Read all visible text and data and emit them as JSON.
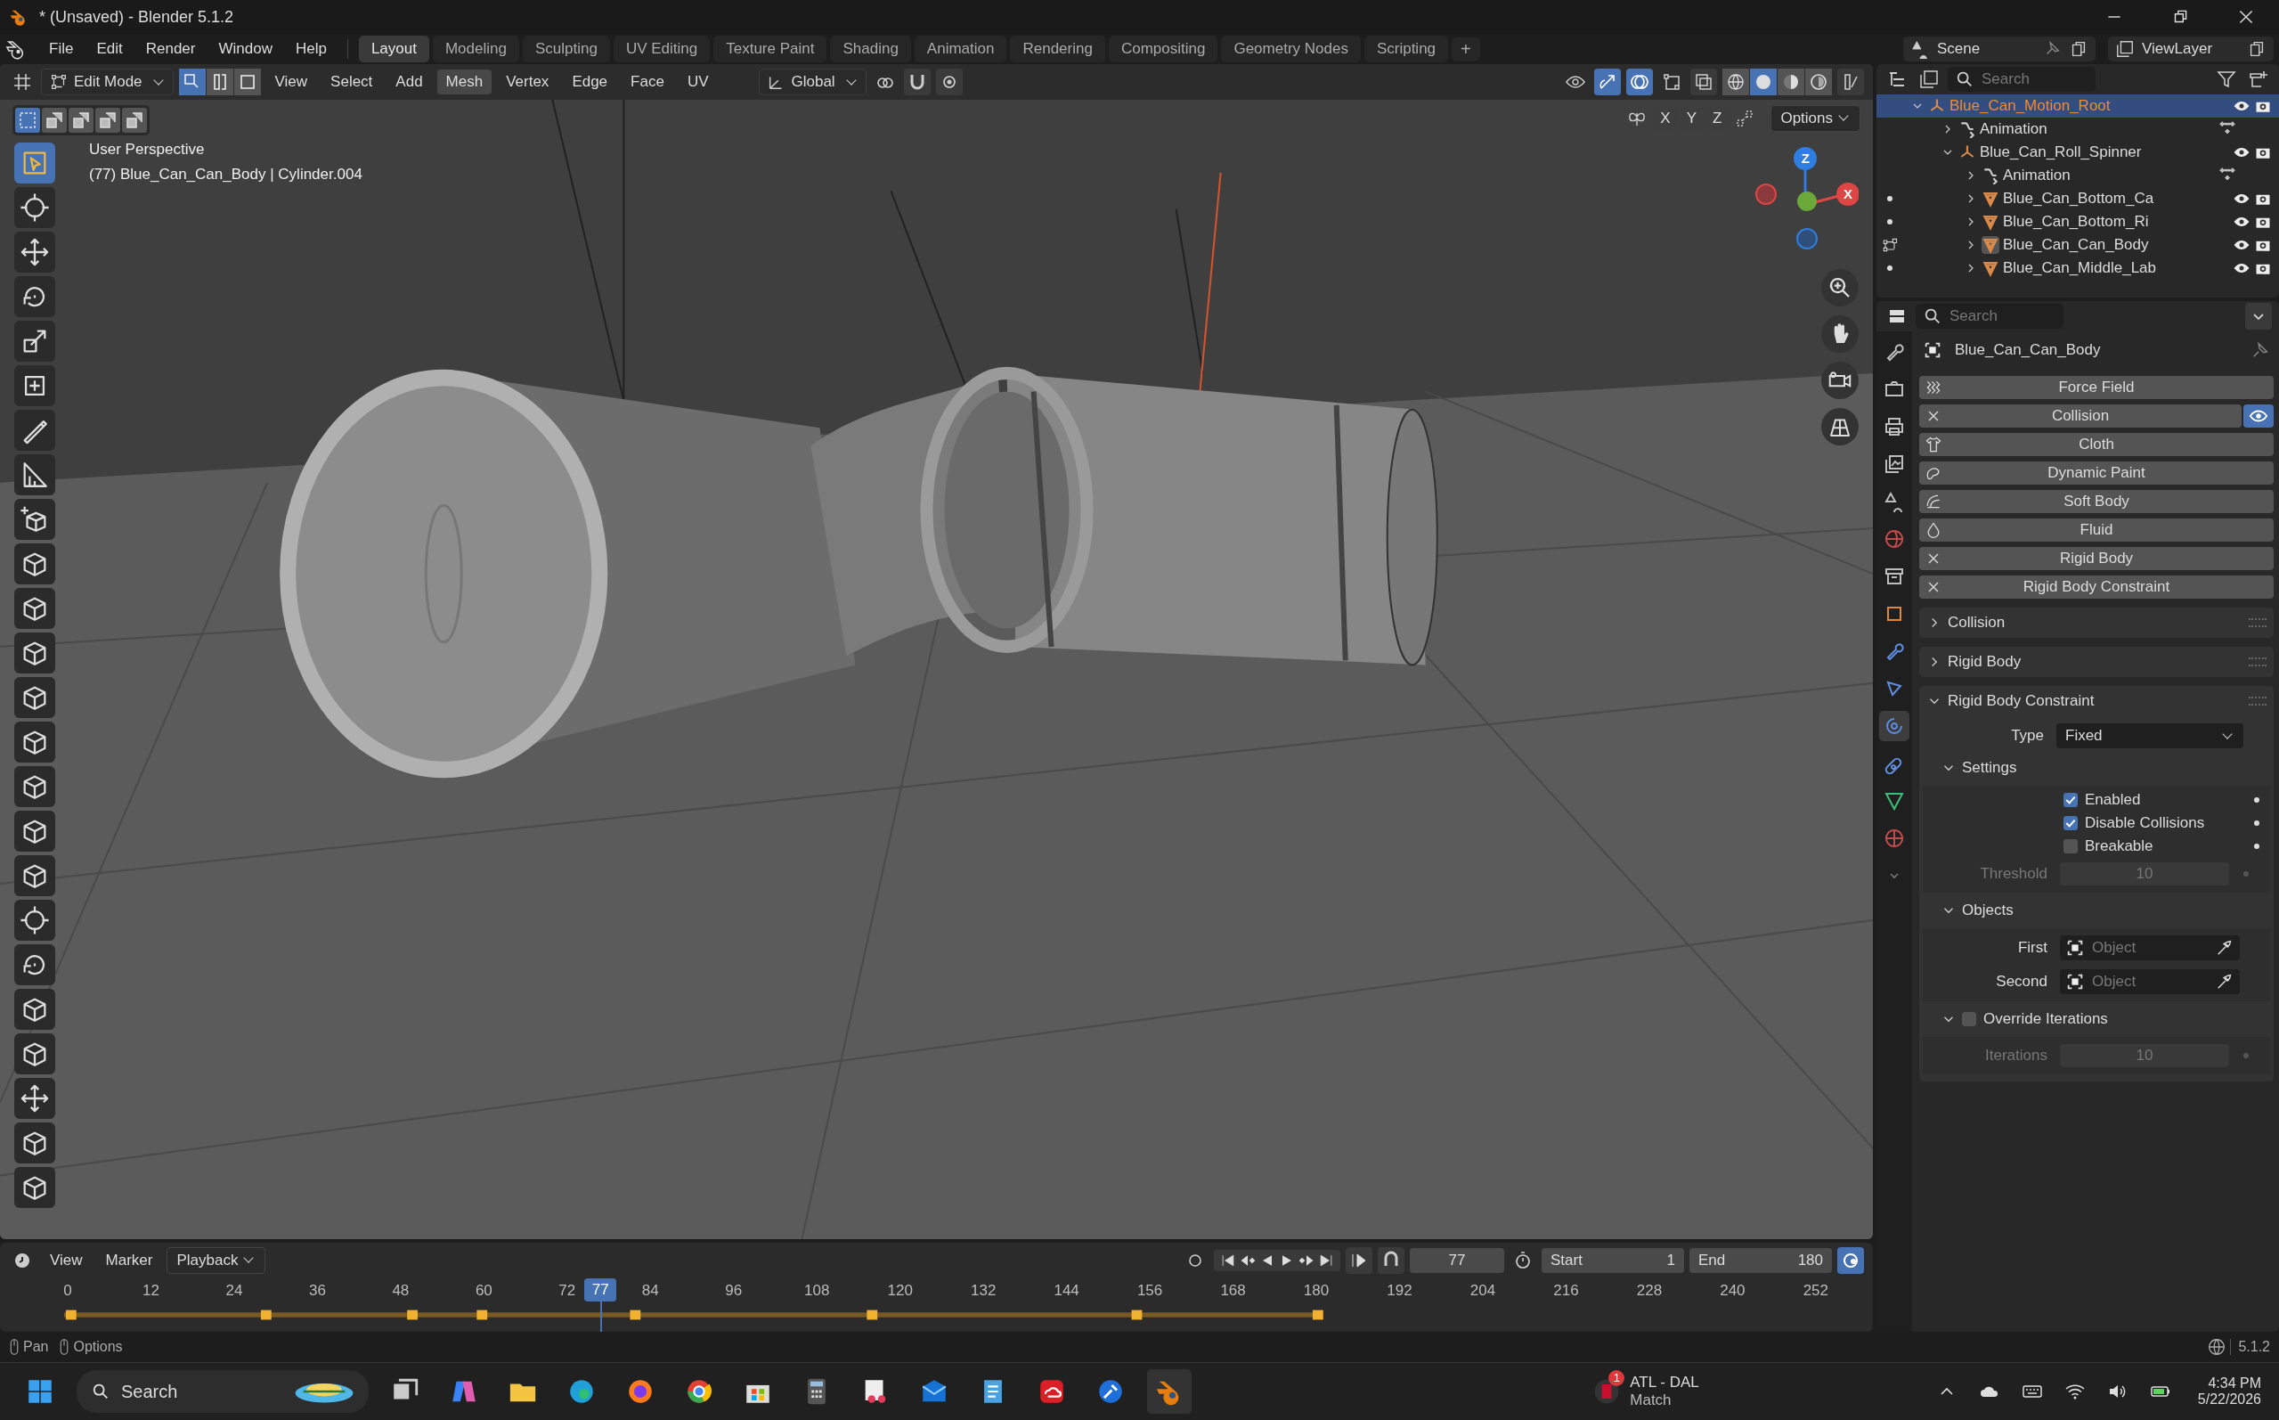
{
  "window": {
    "title": "* (Unsaved) - Blender 5.1.2"
  },
  "menu": [
    "File",
    "Edit",
    "Render",
    "Window",
    "Help"
  ],
  "workspaces": [
    {
      "label": "Layout",
      "selected": true
    },
    {
      "label": "Modeling",
      "selected": false
    },
    {
      "label": "Sculpting",
      "selected": false
    },
    {
      "label": "UV Editing",
      "selected": false
    },
    {
      "label": "Texture Paint",
      "selected": false
    },
    {
      "label": "Shading",
      "selected": false
    },
    {
      "label": "Animation",
      "selected": false
    },
    {
      "label": "Rendering",
      "selected": false
    },
    {
      "label": "Compositing",
      "selected": false
    },
    {
      "label": "Geometry Nodes",
      "selected": false
    },
    {
      "label": "Scripting",
      "selected": false
    }
  ],
  "add_workspace": "+",
  "scene": "Scene",
  "view_layer": "ViewLayer",
  "viewport": {
    "mode": "Edit Mode",
    "select_modes": [
      {
        "kind": "vertex",
        "selected": true
      },
      {
        "kind": "edge",
        "selected": false
      },
      {
        "kind": "face",
        "selected": false
      }
    ],
    "menus": [
      {
        "label": "View",
        "selected": false
      },
      {
        "label": "Select",
        "selected": false
      },
      {
        "label": "Add",
        "selected": false
      },
      {
        "label": "Mesh",
        "selected": true
      },
      {
        "label": "Vertex",
        "selected": false
      },
      {
        "label": "Edge",
        "selected": false
      },
      {
        "label": "Face",
        "selected": false
      },
      {
        "label": "UV",
        "selected": false
      }
    ],
    "orientation": "Global",
    "shading_modes": [
      {
        "kind": "wireframe",
        "selected": false
      },
      {
        "kind": "solid",
        "selected": true
      },
      {
        "kind": "material",
        "selected": false
      },
      {
        "kind": "rendered",
        "selected": false
      }
    ],
    "overlay_lines": [
      "User Perspective",
      "(77) Blue_Can_Can_Body | Cylinder.004"
    ],
    "mirror_axes": [
      "X",
      "Y",
      "Z"
    ],
    "options": "Options",
    "gizmo_labels": [
      {
        "kind": "z",
        "label": "Z"
      },
      {
        "kind": "x",
        "label": "X"
      }
    ],
    "tools": [
      {
        "kind": "select",
        "selected": true
      },
      {
        "kind": "cursor",
        "selected": false
      },
      {
        "kind": "move",
        "selected": false
      },
      {
        "kind": "rotate",
        "selected": false
      },
      {
        "kind": "scale",
        "selected": false
      },
      {
        "kind": "transform",
        "selected": false
      },
      {
        "kind": "annotate",
        "selected": false
      },
      {
        "kind": "measure",
        "selected": false
      },
      {
        "kind": "add-cube",
        "selected": false
      },
      {
        "kind": "cube",
        "selected": false
      },
      {
        "kind": "cube",
        "selected": false
      },
      {
        "kind": "cube",
        "selected": false
      },
      {
        "kind": "cube",
        "selected": false
      },
      {
        "kind": "cube",
        "selected": false
      },
      {
        "kind": "cube",
        "selected": false
      },
      {
        "kind": "cube",
        "selected": false
      },
      {
        "kind": "cube",
        "selected": false
      },
      {
        "kind": "cursor",
        "selected": false
      },
      {
        "kind": "rotate",
        "selected": false
      },
      {
        "kind": "cube",
        "selected": false
      },
      {
        "kind": "cube",
        "selected": false
      },
      {
        "kind": "move",
        "selected": false
      },
      {
        "kind": "cube",
        "selected": false
      },
      {
        "kind": "cube",
        "selected": false
      }
    ]
  },
  "outliner": {
    "search": "Search",
    "items": [
      {
        "label": "Blue_Can_Motion_Root",
        "kind": "empty",
        "selected": true,
        "expanded": true,
        "children": [
          {
            "label": "Animation",
            "kind": "animation",
            "selected": false,
            "expanded": false
          },
          {
            "label": "Blue_Can_Roll_Spinner",
            "kind": "empty",
            "selected": false,
            "expanded": true,
            "children": [
              {
                "label": "Animation",
                "kind": "animation",
                "selected": false,
                "expanded": false
              },
              {
                "label": "Blue_Can_Bottom_Ca",
                "kind": "mesh",
                "selected": false,
                "expanded": false,
                "editing": false
              },
              {
                "label": "Blue_Can_Bottom_Ri",
                "kind": "mesh",
                "selected": false,
                "expanded": false,
                "editing": false
              },
              {
                "label": "Blue_Can_Can_Body",
                "kind": "mesh",
                "selected": false,
                "expanded": false,
                "editing": true
              },
              {
                "label": "Blue_Can_Middle_Lab",
                "kind": "mesh",
                "selected": false,
                "expanded": false,
                "editing": false
              }
            ]
          }
        ]
      }
    ]
  },
  "properties": {
    "search": "Search",
    "object": "Blue_Can_Can_Body",
    "tabs": [
      {
        "kind": "tool",
        "selected": false
      },
      {
        "kind": "render",
        "selected": false
      },
      {
        "kind": "output",
        "selected": false
      },
      {
        "kind": "view-layer",
        "selected": false
      },
      {
        "kind": "scene",
        "selected": false
      },
      {
        "kind": "world",
        "selected": false
      },
      {
        "kind": "collection",
        "selected": false
      },
      {
        "kind": "object",
        "selected": false
      },
      {
        "kind": "modifiers",
        "selected": false
      },
      {
        "kind": "particles",
        "selected": false
      },
      {
        "kind": "physics",
        "selected": true
      },
      {
        "kind": "constraints",
        "selected": false
      },
      {
        "kind": "data",
        "selected": false
      },
      {
        "kind": "material",
        "selected": false
      }
    ],
    "physics": [
      {
        "label": "Force Field",
        "kind": "force-field",
        "enabled": false,
        "viewport_visible": false
      },
      {
        "label": "Collision",
        "kind": "collision",
        "enabled": true,
        "viewport_visible": true
      },
      {
        "label": "Cloth",
        "kind": "cloth",
        "enabled": false,
        "viewport_visible": false
      },
      {
        "label": "Dynamic Paint",
        "kind": "dynamic-paint",
        "enabled": false,
        "viewport_visible": false
      },
      {
        "label": "Soft Body",
        "kind": "soft-body",
        "enabled": false,
        "viewport_visible": false
      },
      {
        "label": "Fluid",
        "kind": "fluid",
        "enabled": false,
        "viewport_visible": false
      },
      {
        "label": "Rigid Body",
        "kind": "rigid-body",
        "enabled": true,
        "viewport_visible": false
      },
      {
        "label": "Rigid Body Constraint",
        "kind": "rigid-body-constraint",
        "enabled": true,
        "viewport_visible": false
      }
    ],
    "panels": [
      {
        "title": "Collision",
        "expanded": false
      },
      {
        "title": "Rigid Body",
        "expanded": false
      }
    ],
    "constraint": {
      "title": "Rigid Body Constraint",
      "expanded": true,
      "type_label": "Type",
      "type_value": "Fixed",
      "settings": {
        "title": "Settings",
        "expanded": true,
        "checks": [
          {
            "label": "Enabled",
            "checked": true
          },
          {
            "label": "Disable Collisions",
            "checked": true
          },
          {
            "label": "Breakable",
            "checked": false
          }
        ],
        "threshold": {
          "label": "Threshold",
          "value": "10",
          "disabled": true
        }
      },
      "objects": {
        "title": "Objects",
        "expanded": true,
        "fields": [
          {
            "label": "First",
            "placeholder": "Object"
          },
          {
            "label": "Second",
            "placeholder": "Object"
          }
        ]
      },
      "override": {
        "title": "Override Iterations",
        "expanded": true,
        "checked": false,
        "iterations": {
          "label": "Iterations",
          "value": "10",
          "disabled": true
        }
      }
    }
  },
  "timeline": {
    "menus": [
      {
        "label": "View",
        "kind": "menu"
      },
      {
        "label": "Marker",
        "kind": "menu"
      },
      {
        "label": "Playback",
        "kind": "dropdown"
      }
    ],
    "current_frame": "77",
    "start_label": "Start",
    "start": "1",
    "end_label": "End",
    "end": "180",
    "playhead": "77",
    "ticks": [
      "0",
      "12",
      "24",
      "36",
      "48",
      "60",
      "72",
      "84",
      "96",
      "108",
      "120",
      "132",
      "144",
      "156",
      "168",
      "180",
      "192",
      "204",
      "216",
      "228",
      "240",
      "252"
    ]
  },
  "status_bar": {
    "hints": [
      "Pan",
      "Options"
    ],
    "version": "5.1.2"
  },
  "taskbar": {
    "search": "Search",
    "notification": {
      "badge": "1",
      "title": "ATL - DAL",
      "subtitle": "Match"
    },
    "time": "4:34 PM",
    "date": "5/22/2026"
  }
}
